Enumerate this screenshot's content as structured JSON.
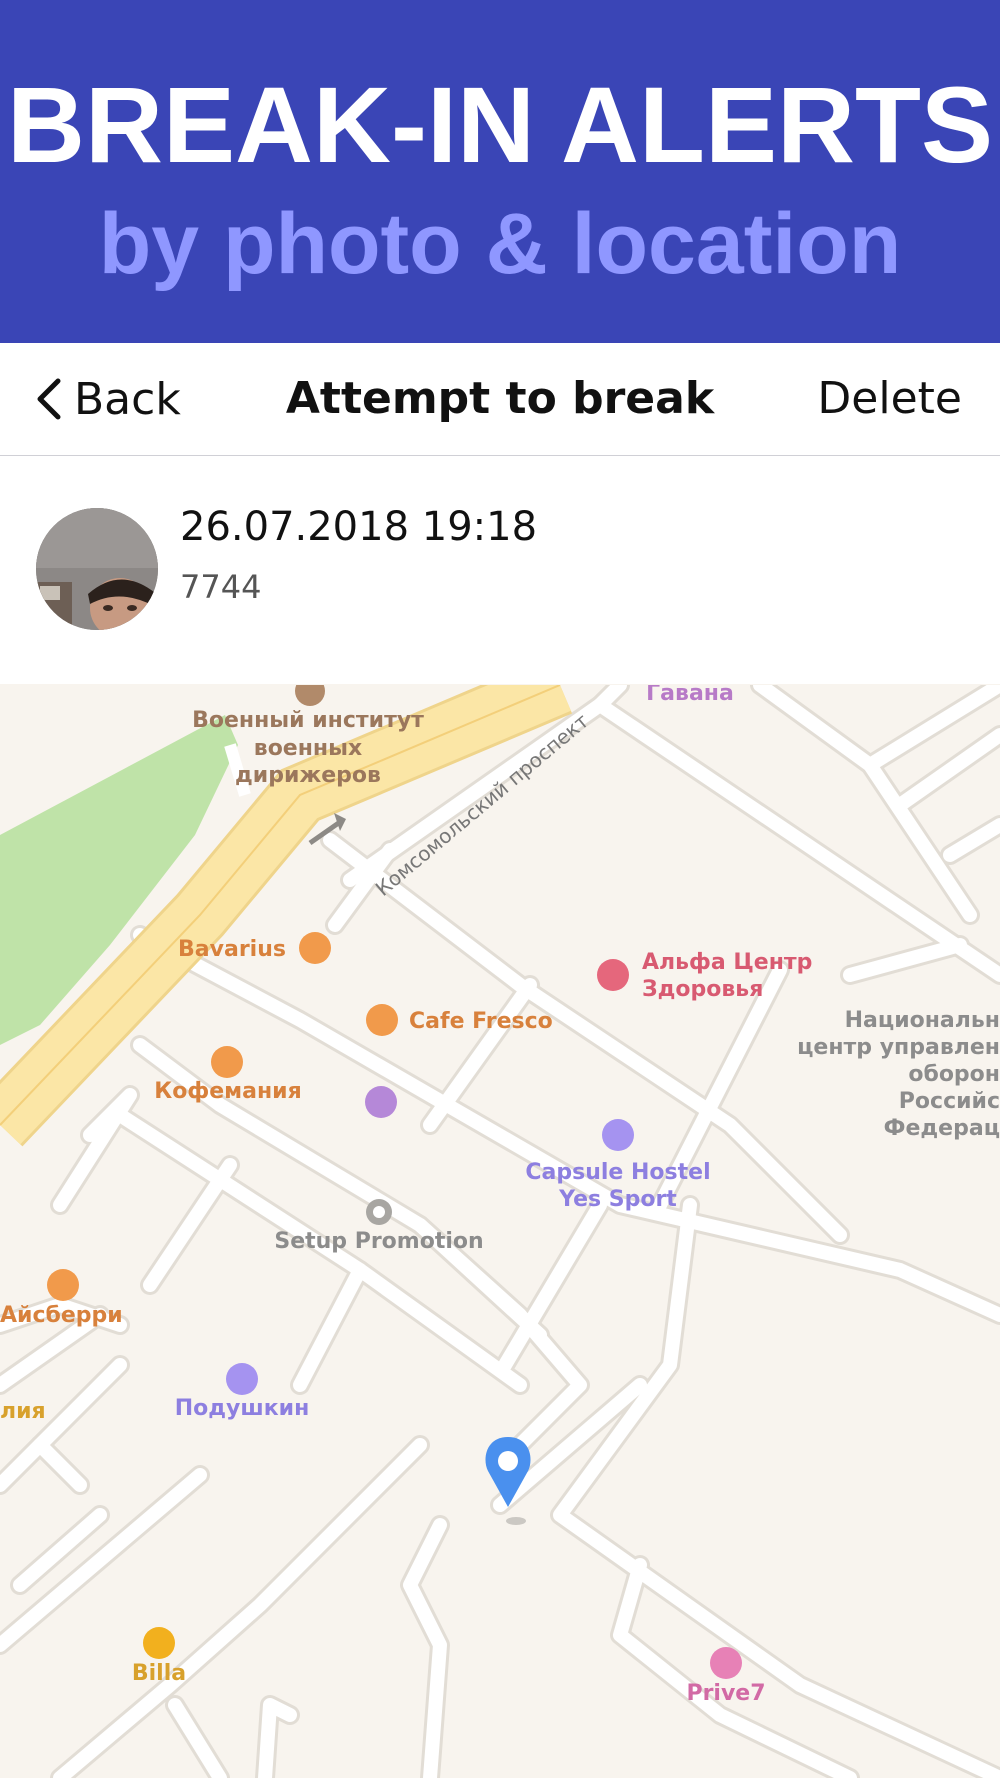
{
  "banner": {
    "title": "BREAK-IN ALERTS",
    "subtitle": "by photo & location"
  },
  "navbar": {
    "back_label": "Back",
    "title": "Attempt to break",
    "delete_label": "Delete"
  },
  "entry": {
    "datetime": "26.07.2018 19:18",
    "code": "7744"
  },
  "map": {
    "labels": {
      "havana": "Гавана",
      "military_1": "Военный институт",
      "military_2": "военных",
      "military_3": "дирижеров",
      "street": "Комсомольский проспект",
      "bavarius": "Bavarius",
      "alfa_1": "Альфа Центр",
      "alfa_2": "Здоровья",
      "national_1": "Национальн",
      "national_2": "центр управлен",
      "national_3": "оборон",
      "national_4": "Российс",
      "national_5": "Федерац",
      "cafe_fresco": "Cafe Fresco",
      "kofemania": "Кофемания",
      "capsule_1": "Capsule Hostel",
      "capsule_2": "Yes Sport",
      "setup": "Setup Promotion",
      "aisberri": "Айсберри",
      "liya": "лия",
      "podushkin": "Подушкин",
      "billa": "Billa",
      "prive7": "Prive7"
    }
  },
  "colors": {
    "banner_bg": "#3a45b6",
    "banner_sub": "#8f97ff",
    "pin": "#4a90ee",
    "park": "#bfe3a8",
    "highway": "#fbe6a6"
  },
  "icons": {
    "back": "chevron-left-icon",
    "pin": "location-pin-icon"
  }
}
